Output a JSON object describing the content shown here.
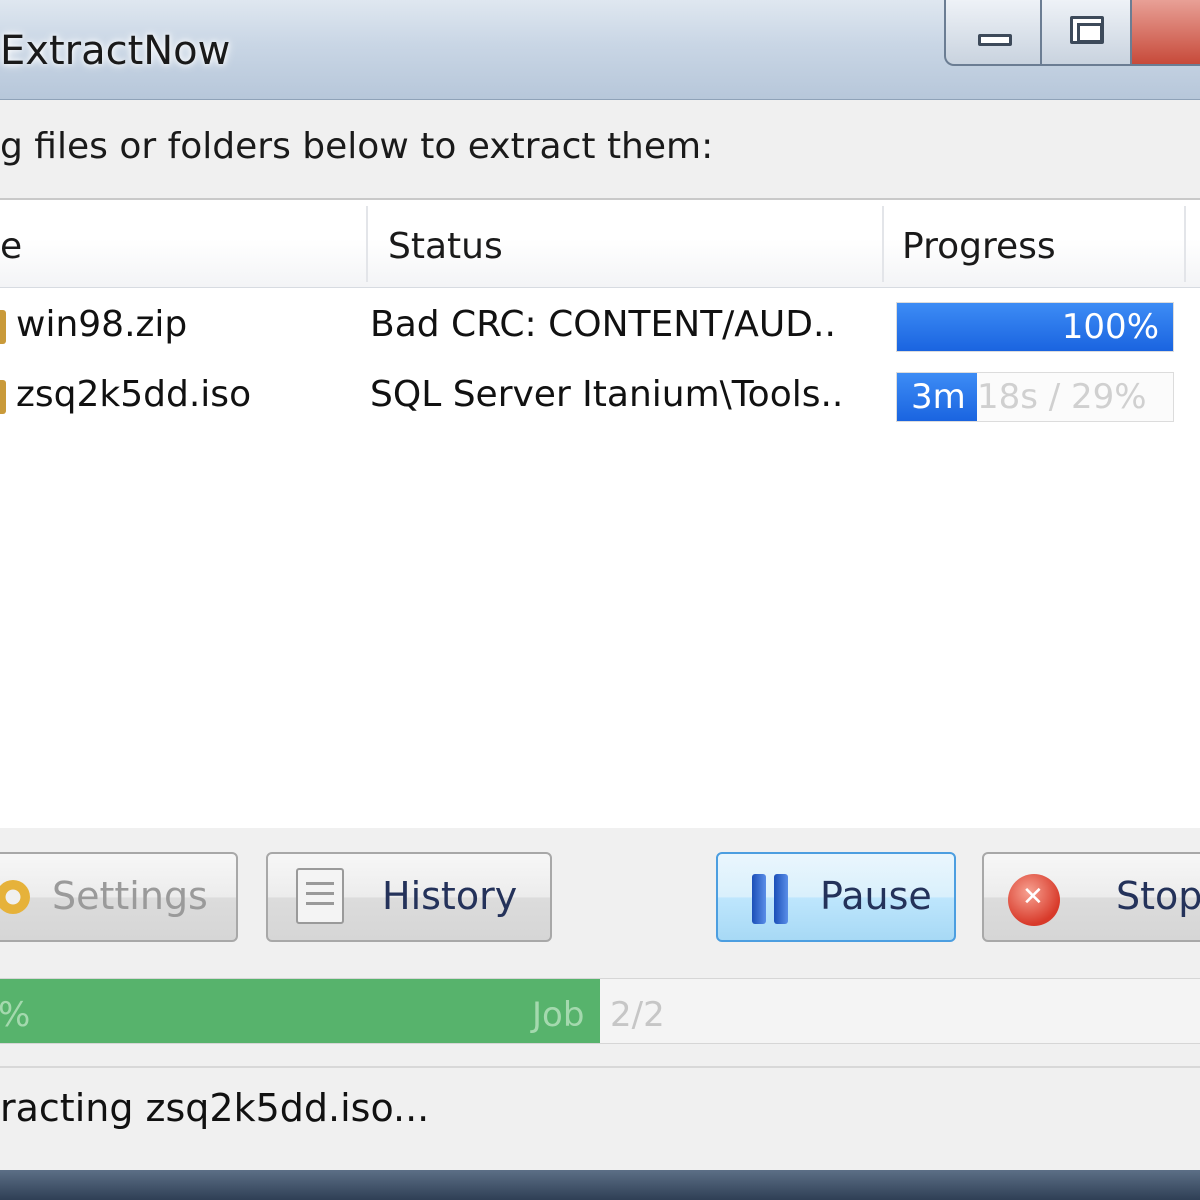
{
  "window": {
    "title": "ExtractNow",
    "instruction": "g files or folders below to extract them:"
  },
  "list": {
    "columns": [
      "e",
      "Status",
      "Progress"
    ],
    "rows": [
      {
        "name": "win98.zip",
        "status": "Bad CRC: CONTENT/AUD..",
        "progress_text": "100%",
        "progress_fraction": 1.0
      },
      {
        "name": "zsq2k5dd.iso",
        "status": "SQL Server Itanium\\Tools..",
        "time_elapsed": "3m",
        "progress_rest": "18s / 29%",
        "progress_fraction": 0.29
      }
    ]
  },
  "buttons": {
    "settings": "Settings",
    "history": "History",
    "pause": "Pause",
    "stop": "Stop"
  },
  "overall": {
    "percent_text": "%",
    "job_label": "Job",
    "job_count": "2/2",
    "fraction": 0.5
  },
  "statusbar": {
    "text": "racting zsq2k5dd.iso..."
  },
  "colors": {
    "progress_blue": "#1a64e0",
    "overall_green": "#57b36c"
  }
}
